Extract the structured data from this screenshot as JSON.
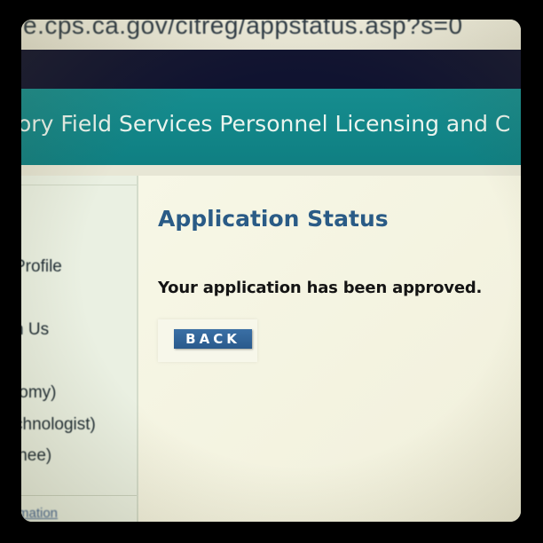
{
  "browser": {
    "address_text": "e.cps.ca.gov/citreg/appstatus.asp?s=0"
  },
  "header": {
    "site_title": "ory Field Services Personnel Licensing and C"
  },
  "sidebar": {
    "items": [
      {
        "label": "Profile"
      },
      {
        "label": "h Us"
      },
      {
        "label": "tomy)"
      },
      {
        "label": "chnologist)"
      },
      {
        "label": "inee)"
      }
    ],
    "bottom_link": "mation"
  },
  "main": {
    "title": "Application Status",
    "message": "Your application has been approved.",
    "back_label": "BACK"
  },
  "colors": {
    "header_teal": "#138a8c",
    "title_blue": "#2a5b86",
    "button_blue": "#2f6498"
  }
}
